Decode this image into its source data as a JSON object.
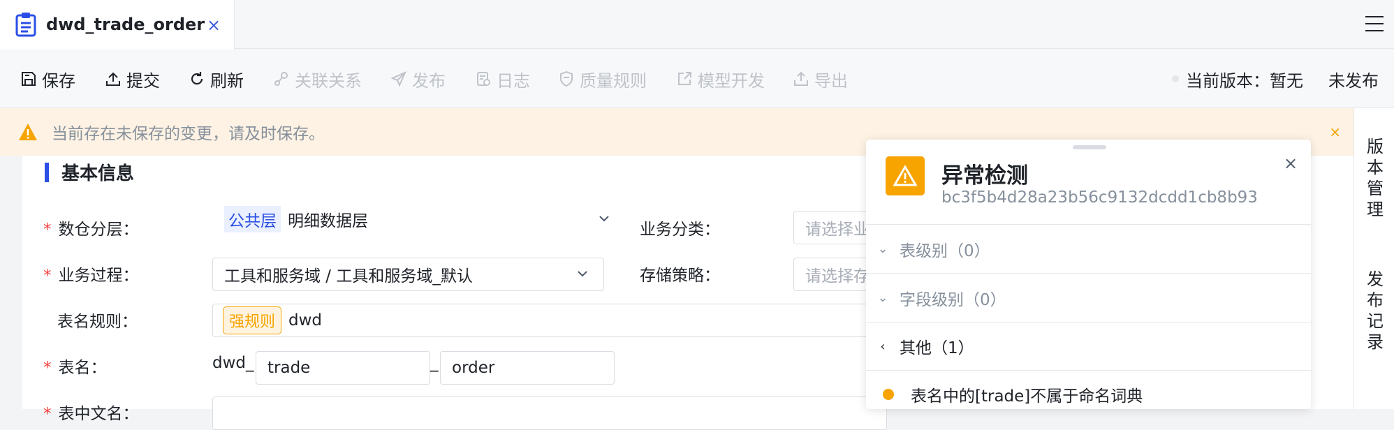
{
  "tab": {
    "title": "dwd_trade_order",
    "close": "×"
  },
  "toolbar": {
    "save": "保存",
    "submit": "提交",
    "refresh": "刷新",
    "relation": "关联关系",
    "publish": "发布",
    "log": "日志",
    "quality": "质量规则",
    "model": "模型开发",
    "export": "导出",
    "version_label": "当前版本：暂无",
    "status": "未发布"
  },
  "banner": {
    "message": "当前存在未保存的变更，请及时保存。",
    "close": "×"
  },
  "sidebar": {
    "version_mgmt": "版本管理",
    "publish_record": "发布记录"
  },
  "section": {
    "title": "基本信息"
  },
  "form": {
    "layer_label": "数仓分层：",
    "layer_tag": "公共层",
    "layer_value": "明细数据层",
    "category_label": "业务分类：",
    "category_placeholder": "请选择业",
    "process_label": "业务过程：",
    "process_value": "工具和服务域 / 工具和服务域_默认",
    "storage_label": "存储策略：",
    "storage_placeholder": "请选择存",
    "naming_label": "表名规则：",
    "naming_tag": "强规则",
    "naming_value": "dwd",
    "table_label": "表名：",
    "table_prefix": "dwd_",
    "table_part1": "trade",
    "table_sep": "_",
    "table_part2": "order",
    "cn_label": "表中文名："
  },
  "panel": {
    "title": "异常检测",
    "hash": "bc3f5b4d28a23b56c9132dcdd1cb8b93",
    "close": "×",
    "groups": [
      {
        "label": "表级别（0）"
      },
      {
        "label": "字段级别（0）"
      },
      {
        "label": "其他（1）"
      }
    ],
    "item": "表名中的[trade]不属于命名词典"
  },
  "colors": {
    "accent": "#2b4ee6",
    "warning": "#f7a400",
    "required": "#f53f3f"
  }
}
